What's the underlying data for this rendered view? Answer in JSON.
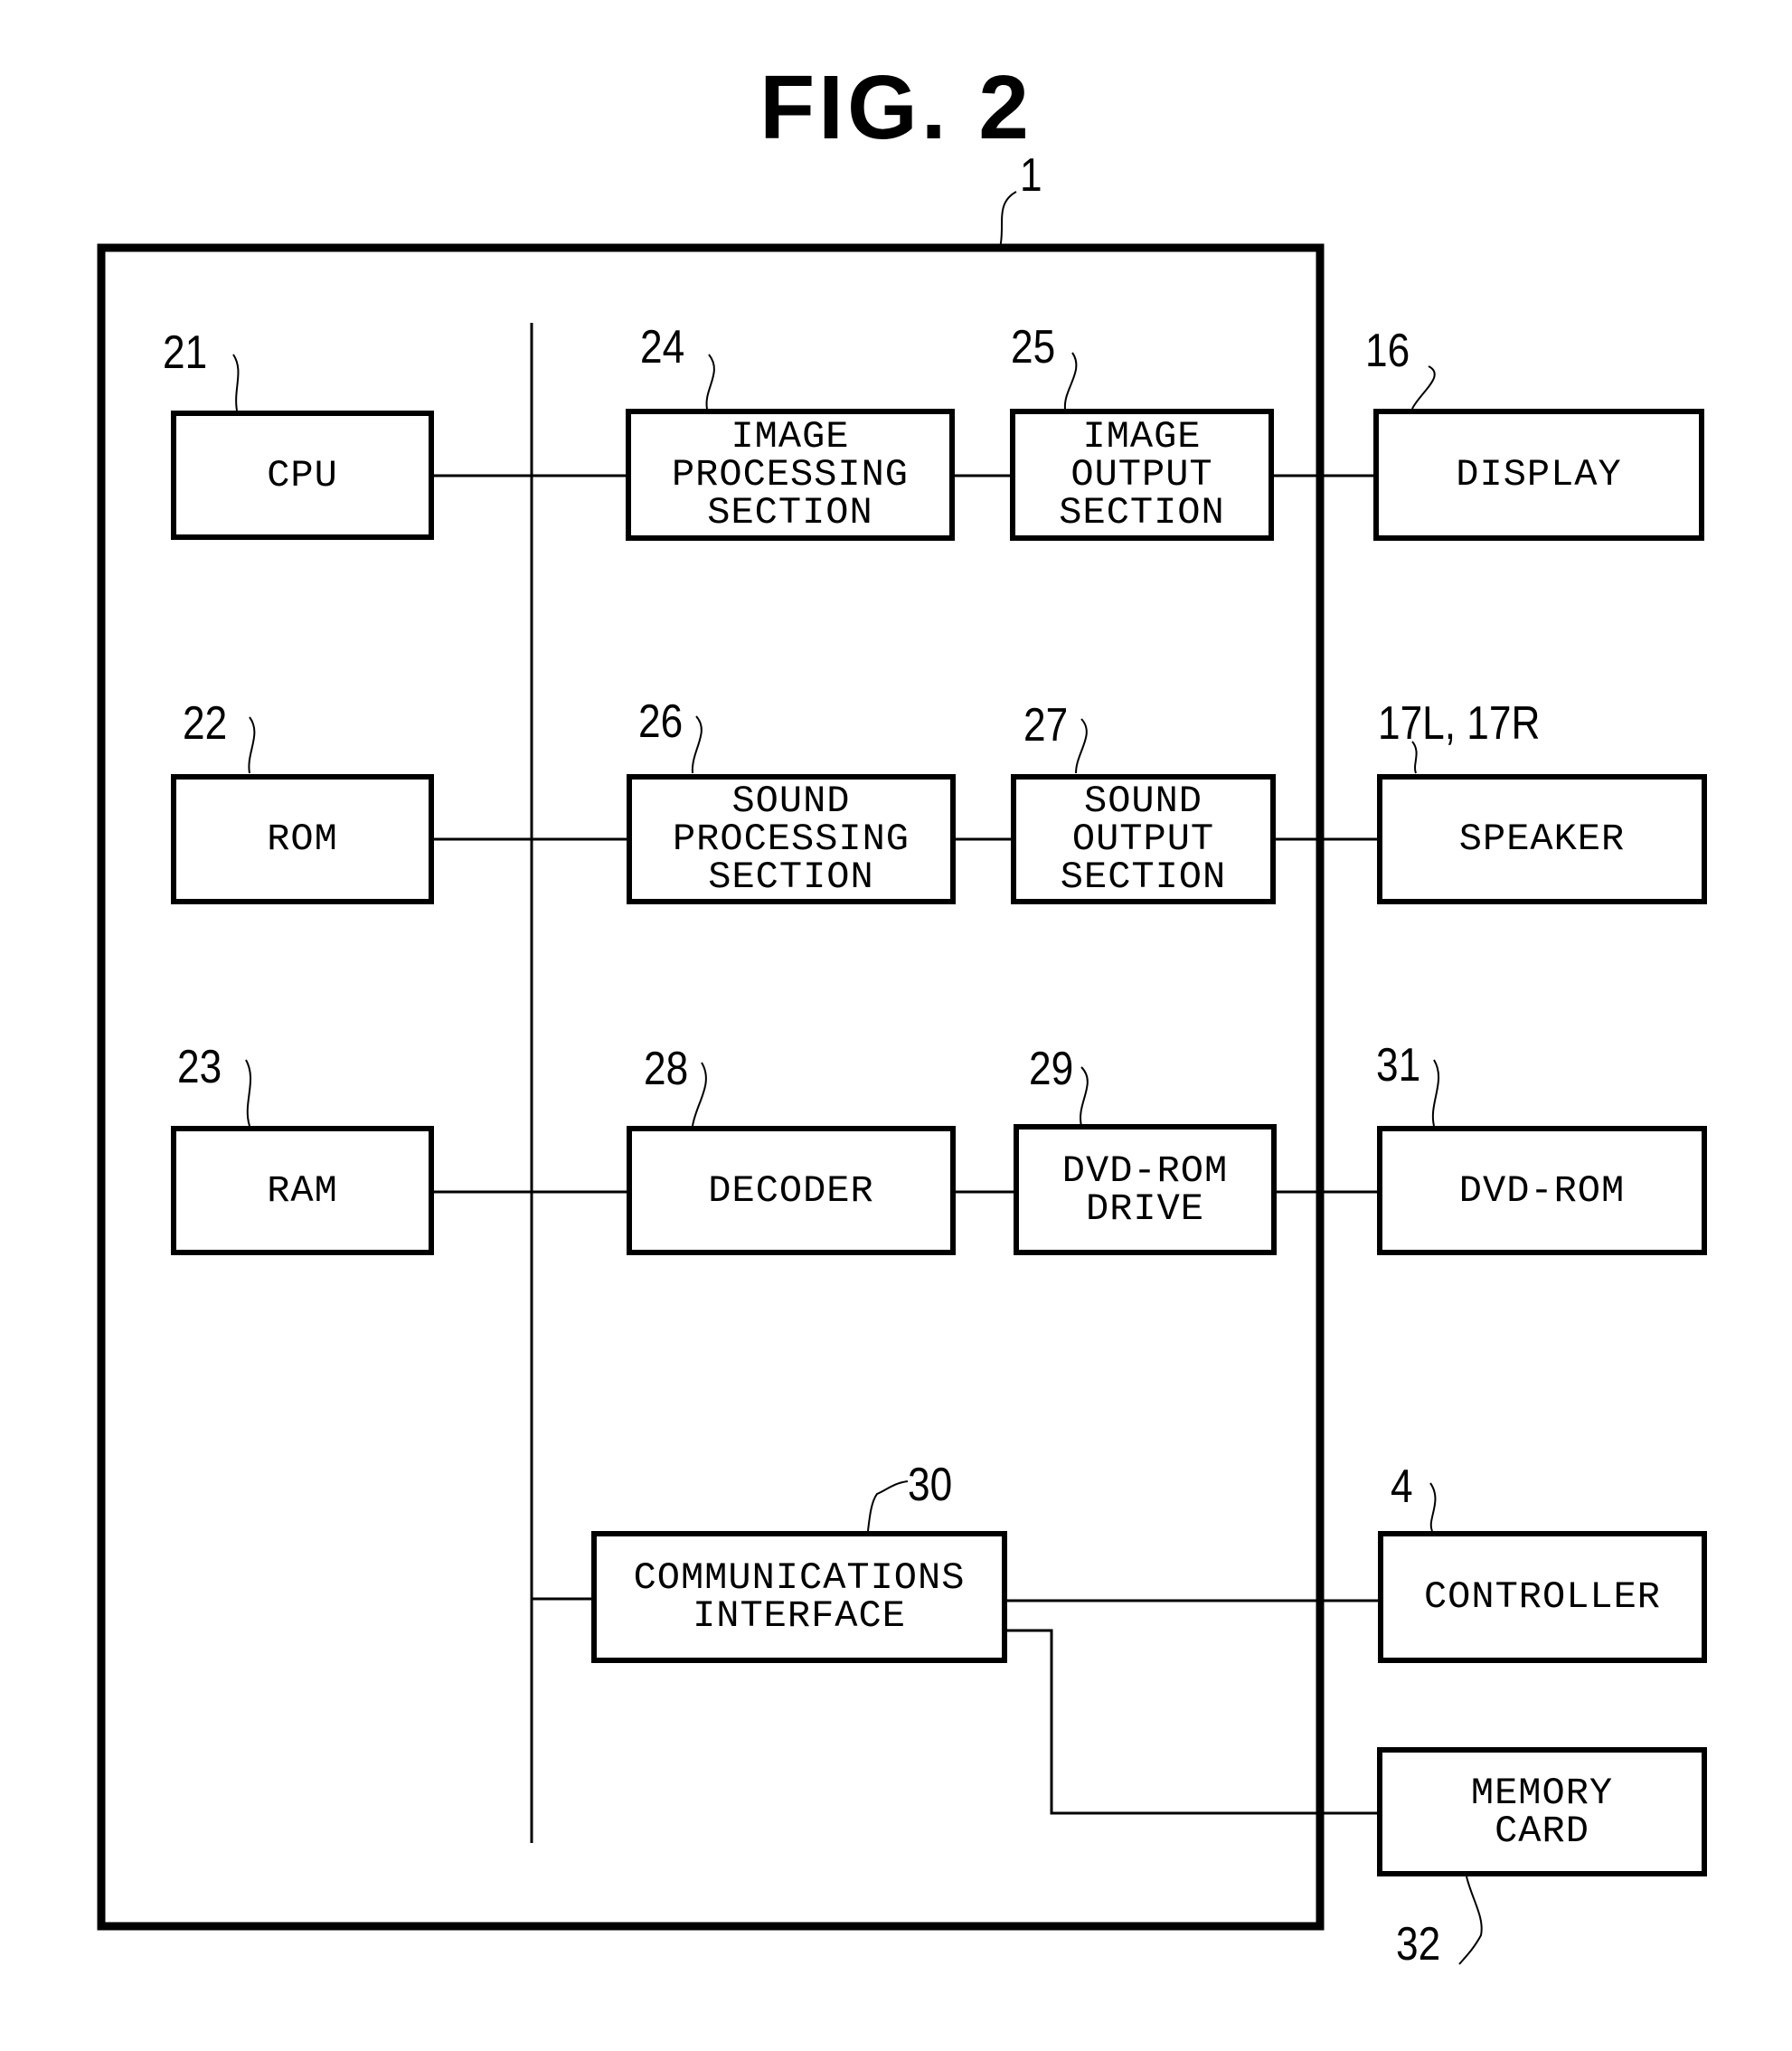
{
  "figure": {
    "title": "FIG. 2",
    "device_ref": "1"
  },
  "blocks": {
    "cpu": {
      "ref": "21",
      "label": "CPU"
    },
    "rom": {
      "ref": "22",
      "label": "ROM"
    },
    "ram": {
      "ref": "23",
      "label": "RAM"
    },
    "image_processing": {
      "ref": "24",
      "label": "IMAGE\nPROCESSING\nSECTION"
    },
    "image_output": {
      "ref": "25",
      "label": "IMAGE\nOUTPUT\nSECTION"
    },
    "sound_processing": {
      "ref": "26",
      "label": "SOUND\nPROCESSING\nSECTION"
    },
    "sound_output": {
      "ref": "27",
      "label": "SOUND\nOUTPUT\nSECTION"
    },
    "decoder": {
      "ref": "28",
      "label": "DECODER"
    },
    "dvd_rom_drive": {
      "ref": "29",
      "label": "DVD-ROM\nDRIVE"
    },
    "communications_interface": {
      "ref": "30",
      "label": "COMMUNICATIONS\nINTERFACE"
    },
    "display": {
      "ref": "16",
      "label": "DISPLAY"
    },
    "speaker": {
      "ref": "17L, 17R",
      "label": "SPEAKER"
    },
    "dvd_rom": {
      "ref": "31",
      "label": "DVD-ROM"
    },
    "controller": {
      "ref": "4",
      "label": "CONTROLLER"
    },
    "memory_card": {
      "ref": "32",
      "label": "MEMORY\nCARD"
    }
  },
  "connections": [
    [
      "cpu",
      "bus"
    ],
    [
      "bus",
      "image_processing"
    ],
    [
      "image_processing",
      "image_output"
    ],
    [
      "image_output",
      "display"
    ],
    [
      "rom",
      "bus"
    ],
    [
      "bus",
      "sound_processing"
    ],
    [
      "sound_processing",
      "sound_output"
    ],
    [
      "sound_output",
      "speaker"
    ],
    [
      "ram",
      "bus"
    ],
    [
      "bus",
      "decoder"
    ],
    [
      "decoder",
      "dvd_rom_drive"
    ],
    [
      "dvd_rom_drive",
      "dvd_rom"
    ],
    [
      "bus",
      "communications_interface"
    ],
    [
      "communications_interface",
      "controller"
    ],
    [
      "communications_interface",
      "memory_card"
    ]
  ]
}
